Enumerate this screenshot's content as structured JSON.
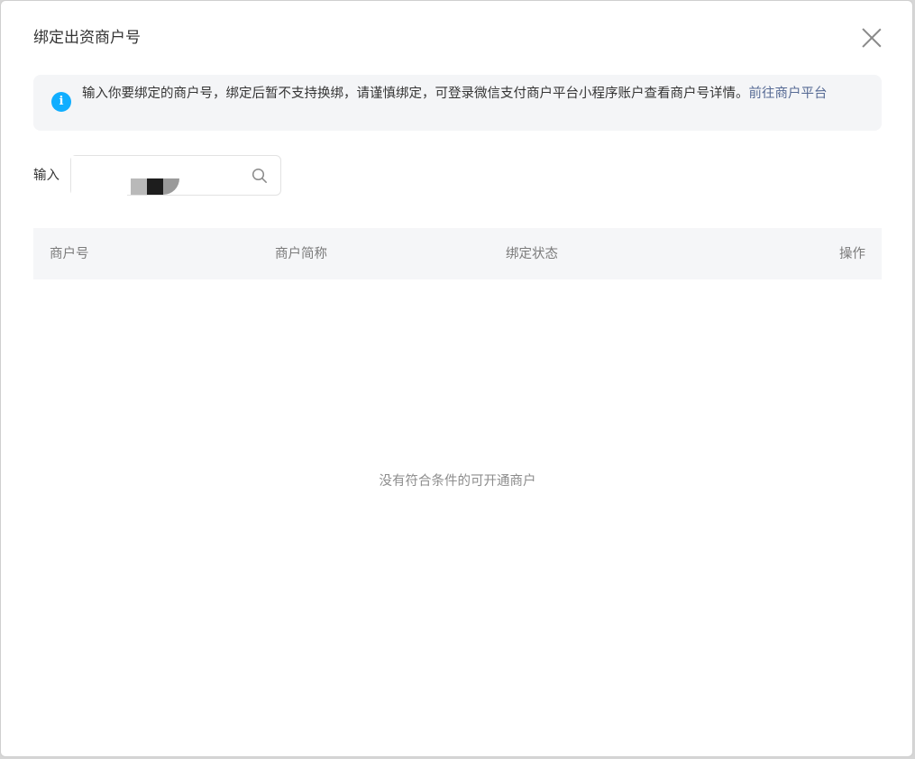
{
  "dialog": {
    "title": "绑定出资商户号"
  },
  "notice": {
    "icon": "info-icon",
    "icon_glyph": "i",
    "text": "输入你要绑定的商户号，绑定后暂不支持换绑，请谨慎绑定，可登录微信支付商户平台小程序账户查看商户号详情。",
    "link_label": "前往商户平台"
  },
  "search": {
    "label": "输入",
    "value": "",
    "icon": "search-icon"
  },
  "table": {
    "columns": [
      "商户号",
      "商户简称",
      "绑定状态",
      "操作"
    ],
    "rows": [],
    "empty_text": "没有符合条件的可开通商户"
  },
  "colors": {
    "accent": "#10aeff",
    "link": "#576b95",
    "header_bg": "#f5f6f8",
    "notice_bg": "#f4f5f7"
  }
}
